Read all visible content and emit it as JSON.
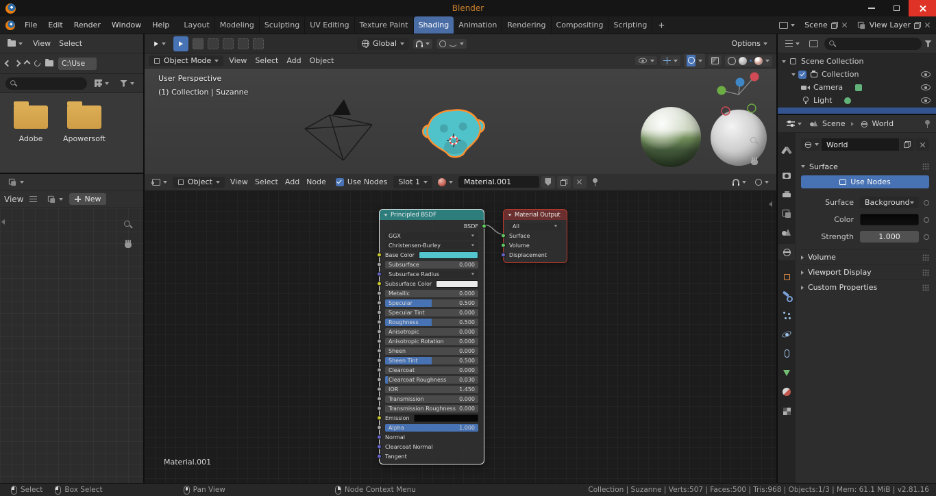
{
  "window": {
    "title": "Blender"
  },
  "topbar": {
    "menus": [
      "File",
      "Edit",
      "Render",
      "Window",
      "Help"
    ],
    "workspaces": [
      "Layout",
      "Modeling",
      "Sculpting",
      "UV Editing",
      "Texture Paint",
      "Shading",
      "Animation",
      "Rendering",
      "Compositing",
      "Scripting"
    ],
    "active_workspace": "Shading",
    "add_tab_label": "+",
    "scene_label": "Scene",
    "view_layer_label": "View Layer"
  },
  "tool_settings": {
    "orientation": "Global",
    "options": "Options"
  },
  "file_browser": {
    "menus": [
      "View",
      "Select"
    ],
    "path": "C:\\Use",
    "folders": [
      "Adobe",
      "Apowersoft"
    ]
  },
  "image_editor": {
    "menus": [
      "View"
    ],
    "new_label": "New"
  },
  "viewport": {
    "mode": "Object Mode",
    "menus": [
      "View",
      "Select",
      "Add",
      "Object"
    ],
    "overlay_title": "User Perspective",
    "overlay_subtitle": "(1) Collection | Suzanne"
  },
  "shader_editor": {
    "type": "Object",
    "menus": [
      "View",
      "Select",
      "Add",
      "Node"
    ],
    "use_nodes_label": "Use Nodes",
    "slot_label": "Slot 1",
    "material_name": "Material.001",
    "canvas_label": "Material.001"
  },
  "nodes": {
    "principled": {
      "title": "Principled BSDF",
      "outputs": [
        "BSDF"
      ],
      "rows": [
        {
          "kind": "select",
          "label": "GGX"
        },
        {
          "kind": "select",
          "label": "Christensen-Burley"
        },
        {
          "kind": "color",
          "label": "Base Color",
          "color": "#54c5cc",
          "socket": "color"
        },
        {
          "kind": "value",
          "label": "Subsurface",
          "value": "0.000",
          "fill": 0,
          "socket": "float"
        },
        {
          "kind": "select",
          "label": "Subsurface Radius",
          "socket": "vector"
        },
        {
          "kind": "color",
          "label": "Subsurface Color",
          "color": "#e9e9e9",
          "socket": "color"
        },
        {
          "kind": "value",
          "label": "Metallic",
          "value": "0.000",
          "fill": 0,
          "socket": "float"
        },
        {
          "kind": "slider",
          "label": "Specular",
          "value": "0.500",
          "fill": 0.5,
          "socket": "float"
        },
        {
          "kind": "value",
          "label": "Specular Tint",
          "value": "0.000",
          "fill": 0,
          "socket": "float"
        },
        {
          "kind": "slider",
          "label": "Roughness",
          "value": "0.500",
          "fill": 0.5,
          "socket": "float"
        },
        {
          "kind": "value",
          "label": "Anisotropic",
          "value": "0.000",
          "fill": 0,
          "socket": "float"
        },
        {
          "kind": "value",
          "label": "Anisotropic Rotation",
          "value": "0.000",
          "fill": 0,
          "socket": "float"
        },
        {
          "kind": "value",
          "label": "Sheen",
          "value": "0.000",
          "fill": 0,
          "socket": "float"
        },
        {
          "kind": "slider",
          "label": "Sheen Tint",
          "value": "0.500",
          "fill": 0.5,
          "socket": "float"
        },
        {
          "kind": "value",
          "label": "Clearcoat",
          "value": "0.000",
          "fill": 0,
          "socket": "float"
        },
        {
          "kind": "value",
          "label": "Clearcoat Roughness",
          "value": "0.030",
          "fill": 0.03,
          "socket": "float"
        },
        {
          "kind": "value",
          "label": "IOR",
          "value": "1.450",
          "fill": 0,
          "socket": "float"
        },
        {
          "kind": "value",
          "label": "Transmission",
          "value": "0.000",
          "fill": 0,
          "socket": "float"
        },
        {
          "kind": "value",
          "label": "Transmission Roughness",
          "value": "0.000",
          "fill": 0,
          "socket": "float"
        },
        {
          "kind": "color",
          "label": "Emission",
          "color": "#070707",
          "socket": "color"
        },
        {
          "kind": "slider",
          "label": "Alpha",
          "value": "1.000",
          "fill": 1,
          "socket": "float"
        },
        {
          "kind": "plain",
          "label": "Normal",
          "socket": "vector"
        },
        {
          "kind": "plain",
          "label": "Clearcoat Normal",
          "socket": "vector"
        },
        {
          "kind": "plain",
          "label": "Tangent",
          "socket": "vector"
        }
      ]
    },
    "material_output": {
      "title": "Material Output",
      "target": "All",
      "inputs": [
        {
          "label": "Surface",
          "socket": "shader"
        },
        {
          "label": "Volume",
          "socket": "shader"
        },
        {
          "label": "Displacement",
          "socket": "vector"
        }
      ]
    }
  },
  "outliner": {
    "rows": [
      {
        "label": "Scene Collection",
        "depth": 0,
        "icon": "scene-collection",
        "disclosure": true,
        "checkbox": false,
        "eye": false,
        "badge": ""
      },
      {
        "label": "Collection",
        "depth": 1,
        "icon": "collection",
        "disclosure": true,
        "checkbox": true,
        "eye": true,
        "badge": ""
      },
      {
        "label": "Camera",
        "depth": 2,
        "icon": "camera",
        "disclosure": false,
        "checkbox": false,
        "eye": true,
        "badge": "badge-cam"
      },
      {
        "label": "Light",
        "depth": 2,
        "icon": "light",
        "disclosure": false,
        "checkbox": false,
        "eye": true,
        "badge": "badge-light"
      }
    ]
  },
  "properties": {
    "breadcrumb": [
      {
        "icon": "scene",
        "label": "Scene"
      },
      {
        "icon": "world",
        "label": "World"
      }
    ],
    "tab_groups": [
      [
        "tool"
      ],
      [
        "render",
        "output",
        "view-layer",
        "scene",
        "world"
      ],
      [
        "object",
        "modifier",
        "particles",
        "physics",
        "constraints",
        "data",
        "material",
        "texture"
      ]
    ],
    "active_tab": "world",
    "world_name": "World",
    "surface": {
      "title": "Surface",
      "use_nodes_label": "Use Nodes",
      "fields": [
        {
          "label": "Surface",
          "kind": "dropdown",
          "value": "Background"
        },
        {
          "label": "Color",
          "kind": "color",
          "value": "#0e0e0e"
        },
        {
          "label": "Strength",
          "kind": "number",
          "value": "1.000"
        }
      ]
    },
    "collapsed_panels": [
      "Volume",
      "Viewport Display",
      "Custom Properties"
    ]
  },
  "statusbar": {
    "hints": [
      {
        "button": "lmb",
        "label": "Select"
      },
      {
        "button": "lmb",
        "label": "Box Select"
      },
      {
        "button": "mmb",
        "label": "Pan View"
      },
      {
        "button": "rmb",
        "label": "Node Context Menu"
      }
    ],
    "info": "Collection | Suzanne | Verts:507 | Faces:500 | Tris:968 | Objects:1/3 | Mem: 61.1 MiB | v2.81.16"
  },
  "colors": {
    "accent": "#4772b3",
    "node_shader_header": "#2d7d7d",
    "node_output_header": "#6b2f2f"
  }
}
